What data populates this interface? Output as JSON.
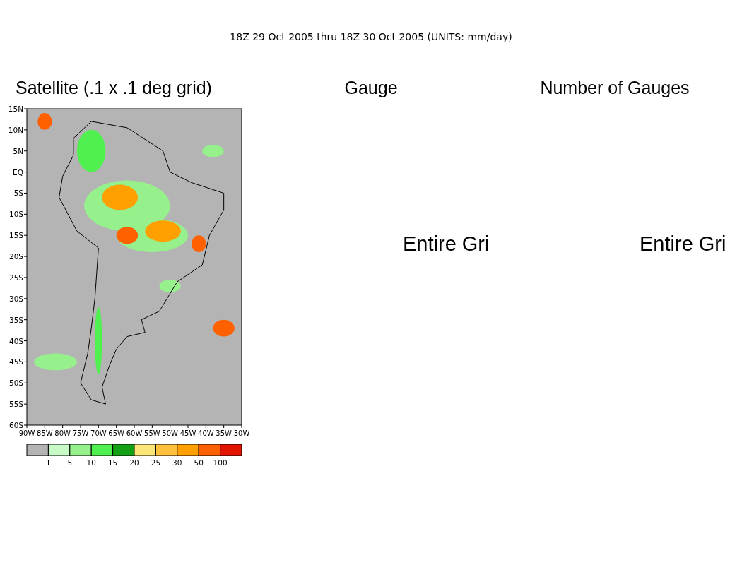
{
  "header": "18Z 29 Oct 2005 thru 18Z 30 Oct 2005 (UNITS: mm/day)",
  "panels": [
    {
      "kind": "map",
      "title": "Satellite (.1 x .1 deg grid)",
      "lat_ticks": [
        "15N",
        "10N",
        "5N",
        "EQ",
        "5S",
        "10S",
        "15S",
        "20S",
        "25S",
        "30S",
        "35S",
        "40S",
        "45S",
        "50S",
        "55S",
        "60S"
      ],
      "lon_ticks": [
        "90W",
        "85W",
        "80W",
        "75W",
        "70W",
        "65W",
        "60W",
        "55W",
        "50W",
        "45W",
        "40W",
        "35W",
        "30W"
      ]
    },
    {
      "kind": "message",
      "title": "Gauge",
      "message": "Entire Gri"
    },
    {
      "kind": "message",
      "title": "Number of Gauges",
      "message": "Entire Gri"
    }
  ],
  "colorbar": {
    "bins": [
      {
        "color": "#b4b4b4"
      },
      {
        "color": "#c8fac8"
      },
      {
        "color": "#96f08c"
      },
      {
        "color": "#50f050"
      },
      {
        "color": "#14a014"
      },
      {
        "color": "#fae678"
      },
      {
        "color": "#ffc03c"
      },
      {
        "color": "#ffa000"
      },
      {
        "color": "#ff6000"
      },
      {
        "color": "#e11400"
      }
    ],
    "labels": [
      "1",
      "5",
      "10",
      "15",
      "20",
      "25",
      "30",
      "50",
      "100"
    ]
  }
}
